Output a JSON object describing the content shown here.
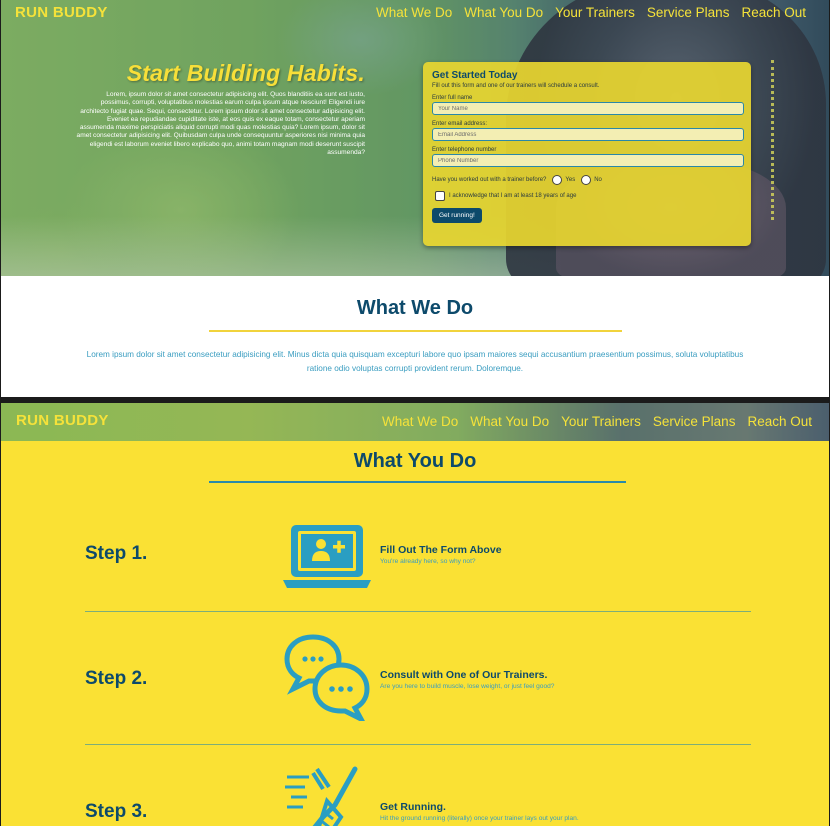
{
  "colors": {
    "accent_yellow": "#f5e23a",
    "navy": "#0d4a6b",
    "teal": "#2a8aa8",
    "page_yellow": "#fae134"
  },
  "brand": "RUN BUDDY",
  "nav": [
    "What We Do",
    "What You Do",
    "Your Trainers",
    "Service Plans",
    "Reach Out"
  ],
  "hero": {
    "title": "Start Building Habits.",
    "text": "Lorem, ipsum dolor sit amet consectetur adipisicing elit. Quos blanditiis ea sunt est iusto, possimus, corrupti, voluptatibus molestias earum culpa ipsum atque nesciunt! Eligendi iure architecto fugiat quae. Sequi, consectetur. Lorem ipsum dolor sit amet consectetur adipisicing elit. Eveniet ea repudiandae cupiditate iste, at eos quis ex eaque totam, consectetur aperiam assumenda maxime perspiciatis aliquid corrupti modi quas molestias quia? Lorem ipsum, dolor sit amet consectetur adipisicing elit. Quibusdam culpa unde consequuntur asperiores nisi minima quia eligendi est laborum eveniet libero explicabo quo, animi totam magnam modi deserunt suscipit assumenda?"
  },
  "form": {
    "title": "Get Started Today",
    "subtitle": "Fill out this form and one of our trainers will schedule a consult.",
    "name_label": "Enter full name",
    "name_placeholder": "Your Name",
    "email_label": "Enter email address:",
    "email_placeholder": "Email Address",
    "phone_label": "Enter telephone number",
    "phone_placeholder": "Phone Number",
    "trainer_question": "Have you worked out with a trainer before?",
    "yes": "Yes",
    "no": "No",
    "acknowledge": "I acknowledge that I am at least 18 years of age",
    "submit": "Get running!"
  },
  "what_we_do": {
    "title": "What We Do",
    "text": "Lorem ipsum dolor sit amet consectetur adipisicing elit. Minus dicta quia quisquam excepturi labore quo ipsam maiores sequi accusantium praesentium possimus, soluta voluptatibus ratione odio voluptas corrupti provident rerum. Doloremque."
  },
  "what_you_do": {
    "title": "What You Do",
    "steps": [
      {
        "label": "Step 1.",
        "icon": "laptop-add-user-icon",
        "title": "Fill Out The Form Above",
        "text": "You're already here, so why not?"
      },
      {
        "label": "Step 2.",
        "icon": "chat-bubbles-icon",
        "title": "Consult with One of Our Trainers.",
        "text": "Are you here to build muscle, lose weight, or just feel good?"
      },
      {
        "label": "Step 3.",
        "icon": "running-shoe-icon",
        "title": "Get Running.",
        "text": "Hit the ground running (literally) once your trainer lays out your plan."
      }
    ]
  }
}
